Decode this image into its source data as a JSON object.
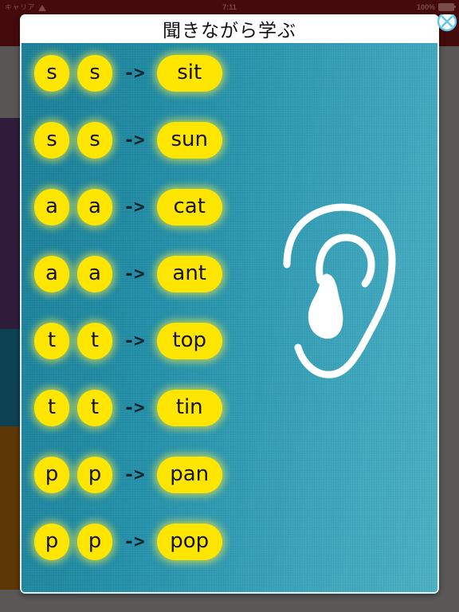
{
  "status_bar": {
    "carrier": "キャリア",
    "wifi_icon": "wifi-icon",
    "time": "7:11",
    "battery_percent": "100%",
    "battery_icon": "battery-full-icon"
  },
  "modal": {
    "title": "聞きながら学ぶ",
    "close_icon": "close-circle-x-icon",
    "ear_icon": "ear-illustration-icon"
  },
  "colors": {
    "teal_left": "#1b7f98",
    "teal_right": "#4db0c4",
    "pill_yellow": "#ffe600",
    "pill_text": "#141414",
    "status_bar_bg": "#430b0b",
    "page_bg": "#5b5757",
    "close_icon": "#5fc6e8"
  },
  "left_bands": [
    {
      "name": "band-gray",
      "color": "#585655"
    },
    {
      "name": "band-purple",
      "color": "#2f1c3a"
    },
    {
      "name": "band-purple-2",
      "color": "#2f1c3a"
    },
    {
      "name": "band-teal",
      "color": "#0c4253"
    },
    {
      "name": "band-brown",
      "color": "#5c3705"
    }
  ],
  "rows": [
    {
      "letter1": "s",
      "letter2": "s",
      "arrow": "->",
      "word": "sit"
    },
    {
      "letter1": "s",
      "letter2": "s",
      "arrow": "->",
      "word": "sun"
    },
    {
      "letter1": "a",
      "letter2": "a",
      "arrow": "->",
      "word": "cat"
    },
    {
      "letter1": "a",
      "letter2": "a",
      "arrow": "->",
      "word": "ant"
    },
    {
      "letter1": "t",
      "letter2": "t",
      "arrow": "->",
      "word": "top"
    },
    {
      "letter1": "t",
      "letter2": "t",
      "arrow": "->",
      "word": "tin"
    },
    {
      "letter1": "p",
      "letter2": "p",
      "arrow": "->",
      "word": "pan"
    },
    {
      "letter1": "p",
      "letter2": "p",
      "arrow": "->",
      "word": "pop"
    }
  ]
}
